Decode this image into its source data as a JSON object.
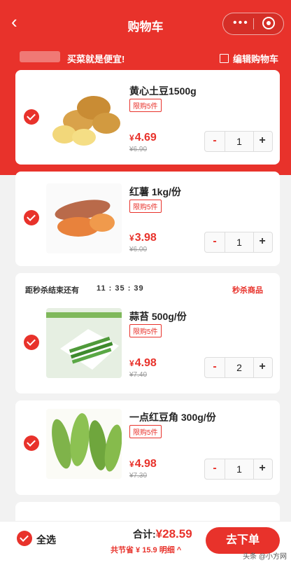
{
  "app": {
    "title": "购物车",
    "back_icon": "chevron-left-icon",
    "menu_icon": "more-dots-icon",
    "close_icon": "target-icon"
  },
  "promo": {
    "slogan": "买菜就是便宜!",
    "edit_label": "编辑购物车"
  },
  "colors": {
    "accent": "#e8322b"
  },
  "items": [
    {
      "name": "黄心土豆1500g",
      "tag": "限购5件",
      "currency": "¥",
      "price": "4.69",
      "orig_price": "¥6.90",
      "qty": "1"
    },
    {
      "name": "红薯 1kg/份",
      "tag": "限购5件",
      "currency": "¥",
      "price": "3.98",
      "orig_price": "¥6.00",
      "qty": "1"
    },
    {
      "name": "蒜苔 500g/份",
      "tag": "限购5件",
      "currency": "¥",
      "price": "4.98",
      "orig_price": "¥7.40",
      "qty": "2"
    },
    {
      "name": "一点红豆角 300g/份",
      "tag": "限购5件",
      "currency": "¥",
      "price": "4.98",
      "orig_price": "¥7.30",
      "qty": "1"
    }
  ],
  "flash_sale": {
    "label": "距秒杀结束还有",
    "timer": "11 : 35 : 39",
    "link": "秒杀商品"
  },
  "stepper": {
    "minus": "-",
    "plus": "+"
  },
  "footer": {
    "select_all": "全选",
    "total_label": "合计:",
    "total_currency": "¥",
    "total_amount": "28.59",
    "saved": "共节省 ¥ 15.9  明细 ^",
    "order_button": "去下单",
    "watermark": "头条 @小方网"
  }
}
